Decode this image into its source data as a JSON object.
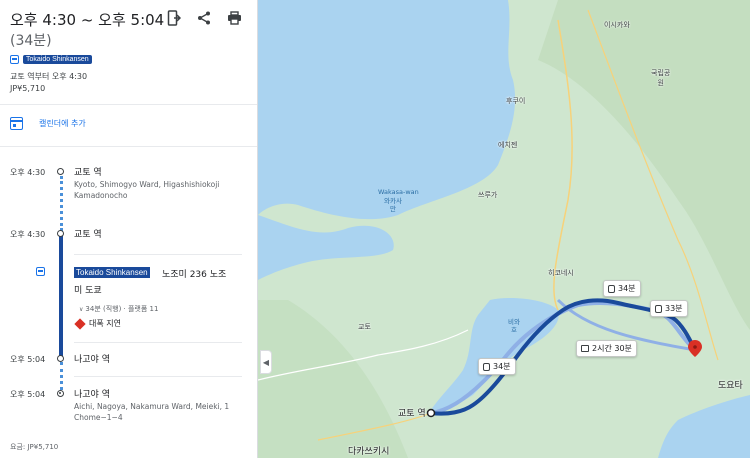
{
  "header": {
    "time_range": "오후 4:30 ~ 오후 5:04",
    "duration": "(34분)",
    "route_name": "Tokaido Shinkansen",
    "depart_from": "교토 역부터 오후 4:30",
    "fare": "JP¥5,710",
    "icons": [
      "mobile-send-icon",
      "share-icon",
      "print-icon"
    ]
  },
  "calendar": {
    "label": "캘린더에 추가"
  },
  "itinerary": {
    "stops": [
      {
        "time": "오후 4:30",
        "name": "교토 역",
        "address": "Kyoto, Shimogyo Ward, Higashishiokoji Kamadonocho"
      },
      {
        "time": "오후 4:30",
        "name": "교토 역"
      },
      {
        "time": "오후 5:04",
        "name": "나고야 역"
      },
      {
        "time": "오후 5:04",
        "name": "나고야 역",
        "address": "Aichi, Nagoya, Nakamura Ward, Meieki, 1 Chome−1−4"
      }
    ],
    "leg": {
      "line": "Tokaido Shinkansen",
      "train": "노조미 236 노조",
      "train2": "미 도쿄",
      "meta": "34분 (직행) · 플랫폼 11",
      "alert": "대폭 지연"
    },
    "fare_footer": "요금: JP¥5,710"
  },
  "map": {
    "labels": {
      "wakasa": "Wakasa-wan",
      "wakasa_kr": "와카사\n만",
      "kyoto": "교토 역",
      "kyoto_city": "교토",
      "nagoya": "도요타",
      "ishikawa": "이시카와",
      "kokuritsu": "국립공\n원",
      "takasaki": "다카쓰키시",
      "biwa": "비와\n호",
      "hikone": "히코네시",
      "tsuruga": "쓰루가",
      "fukui": "후쿠이",
      "echizen": "에치젠"
    },
    "routes": [
      {
        "label": "34분",
        "mode": "train"
      },
      {
        "label": "34분",
        "mode": "train"
      },
      {
        "label": "33분",
        "mode": "train"
      },
      {
        "label": "2시간 30분",
        "mode": "bus"
      }
    ]
  },
  "colors": {
    "route_primary": "#1a4a9b",
    "route_alt": "#8fb0e6",
    "accent": "#1a73e8",
    "alert": "#d93025",
    "water": "#aad3f0",
    "land": "#cfe6cf"
  }
}
